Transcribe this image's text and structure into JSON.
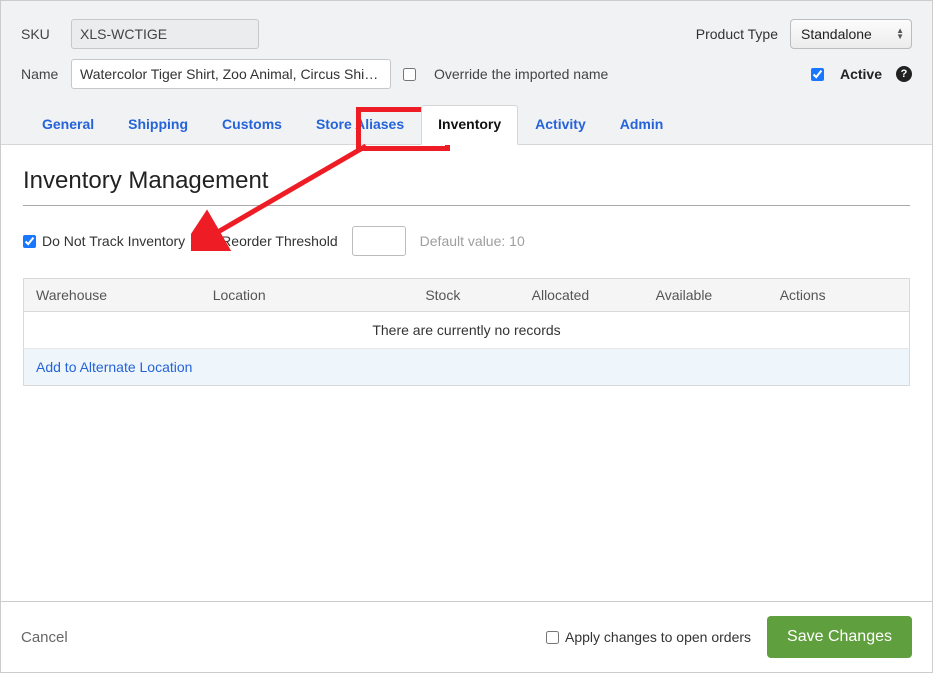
{
  "header": {
    "sku_label": "SKU",
    "sku_value": "XLS-WCTIGE",
    "name_label": "Name",
    "name_value": "Watercolor Tiger Shirt, Zoo Animal, Circus Shirt, …",
    "product_type_label": "Product Type",
    "product_type_value": "Standalone",
    "override_label": "Override the imported name",
    "override_checked": false,
    "active_label": "Active",
    "active_checked": true
  },
  "tabs": [
    "General",
    "Shipping",
    "Customs",
    "Store Aliases",
    "Inventory",
    "Activity",
    "Admin"
  ],
  "active_tab_index": 4,
  "section": {
    "title": "Inventory Management",
    "dont_track_label": "Do Not Track Inventory",
    "dont_track_checked": true,
    "reorder_label": "Reorder Threshold",
    "reorder_value": "",
    "default_value_text": "Default value: 10"
  },
  "table": {
    "columns": [
      "Warehouse",
      "Location",
      "Stock",
      "Allocated",
      "Available",
      "Actions"
    ],
    "no_records_text": "There are currently no records",
    "add_location_text": "Add to Alternate Location"
  },
  "footer": {
    "cancel_label": "Cancel",
    "apply_label": "Apply changes to open orders",
    "apply_checked": false,
    "save_label": "Save Changes"
  },
  "colors": {
    "accent_blue": "#2563d9",
    "save_green": "#5f9f3d",
    "annotation_red": "#ee1c25"
  }
}
